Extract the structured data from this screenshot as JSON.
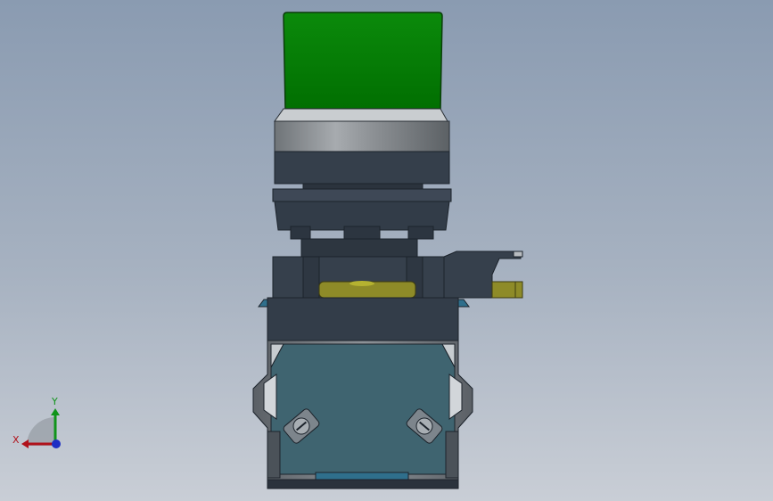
{
  "viewport": {
    "background_top": "#8a9bb1",
    "background_bottom": "#c9ced6"
  },
  "model": {
    "description_icon": "push-button-switch-model",
    "colors": {
      "green_cap": "#017801",
      "bezel_silver": "#9a9fa3",
      "body_dark": "#34404e",
      "contact_block": "#3f6470",
      "terminal_yellow": "#8c8a28",
      "clip_blue": "#2f6f8c",
      "outline": "#1c232b"
    }
  },
  "triad": {
    "x_label": "X",
    "y_label": "Y",
    "x_color": "#b0121b",
    "y_color": "#10941a",
    "origin_color": "#1d2ec4"
  }
}
